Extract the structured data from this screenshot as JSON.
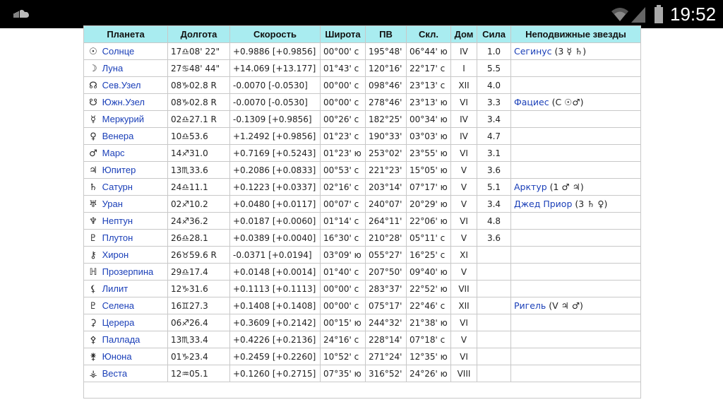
{
  "status_bar": {
    "time": "19:52",
    "icons": [
      "soundcloud-icon",
      "wifi-icon",
      "signal-icon",
      "battery-icon"
    ]
  },
  "table": {
    "headers": [
      "Планета",
      "Долгота",
      "Скорость",
      "Широта",
      "ПВ",
      "Скл.",
      "Дом",
      "Сила",
      "Неподвижные звезды"
    ],
    "rows": [
      {
        "sym": "☉",
        "planet": "Солнце",
        "long": "17♎08' 22\"",
        "speed": "+0.9886  [+0.9856]",
        "lat": "00°00' с",
        "ra": "195°48'",
        "dec": "06°44' ю",
        "house": "IV",
        "power": "1.0",
        "star": "Сегинус",
        "star_cfg": " (3 ☿ ♄)"
      },
      {
        "sym": "☽",
        "planet": "Луна",
        "long": "27♋48' 44\"",
        "speed": "+14.069  [+13.177]",
        "lat": "01°43' с",
        "ra": "120°16'",
        "dec": "22°17' с",
        "house": "I",
        "power": "5.5",
        "star": "",
        "star_cfg": ""
      },
      {
        "sym": "☊",
        "planet": "Сев.Узел",
        "long": "08♑02.8  R",
        "speed": "-0.0070  [-0.0530]",
        "lat": "00°00' с",
        "ra": "098°46'",
        "dec": "23°13' с",
        "house": "XII",
        "power": "4.0",
        "star": "",
        "star_cfg": ""
      },
      {
        "sym": "☋",
        "planet": "Южн.Узел",
        "long": "08♑02.8  R",
        "speed": "-0.0070  [-0.0530]",
        "lat": "00°00' с",
        "ra": "278°46'",
        "dec": "23°13' ю",
        "house": "VI",
        "power": "3.3",
        "star": "Фациес",
        "star_cfg": " (С ☉♂)"
      },
      {
        "sym": "☿",
        "planet": "Меркурий",
        "long": "02♎27.1  R",
        "speed": "-0.1309  [+0.9856]",
        "lat": "00°26' с",
        "ra": "182°25'",
        "dec": "00°34' ю",
        "house": "IV",
        "power": "3.4",
        "star": "",
        "star_cfg": ""
      },
      {
        "sym": "♀",
        "planet": "Венера",
        "long": "10♎53.6",
        "speed": "+1.2492  [+0.9856]",
        "lat": "01°23' с",
        "ra": "190°33'",
        "dec": "03°03' ю",
        "house": "IV",
        "power": "4.7",
        "star": "",
        "star_cfg": ""
      },
      {
        "sym": "♂",
        "planet": "Марс",
        "long": "14♐31.0",
        "speed": "+0.7169  [+0.5243]",
        "lat": "01°23' ю",
        "ra": "253°02'",
        "dec": "23°55' ю",
        "house": "VI",
        "power": "3.1",
        "star": "",
        "star_cfg": ""
      },
      {
        "sym": "♃",
        "planet": "Юпитер",
        "long": "13♏33.6",
        "speed": "+0.2086  [+0.0833]",
        "lat": "00°53' с",
        "ra": "221°23'",
        "dec": "15°05' ю",
        "house": "V",
        "power": "3.6",
        "star": "",
        "star_cfg": ""
      },
      {
        "sym": "♄",
        "planet": "Сатурн",
        "long": "24♎11.1",
        "speed": "+0.1223  [+0.0337]",
        "lat": "02°16' с",
        "ra": "203°14'",
        "dec": "07°17' ю",
        "house": "V",
        "power": "5.1",
        "star": "Арктур",
        "star_cfg": " (1 ♂ ♃)"
      },
      {
        "sym": "♅",
        "planet": "Уран",
        "long": "02♐10.2",
        "speed": "+0.0480  [+0.0117]",
        "lat": "00°07' с",
        "ra": "240°07'",
        "dec": "20°29' ю",
        "house": "V",
        "power": "3.4",
        "star": "Джед Приор",
        "star_cfg": " (3 ♄ ♀)"
      },
      {
        "sym": "♆",
        "planet": "Нептун",
        "long": "24♐36.2",
        "speed": "+0.0187  [+0.0060]",
        "lat": "01°14' с",
        "ra": "264°11'",
        "dec": "22°06' ю",
        "house": "VI",
        "power": "4.8",
        "star": "",
        "star_cfg": ""
      },
      {
        "sym": "♇",
        "planet": "Плутон",
        "long": "26♎28.1",
        "speed": "+0.0389  [+0.0040]",
        "lat": "16°30' с",
        "ra": "210°28'",
        "dec": "05°11' с",
        "house": "V",
        "power": "3.6",
        "star": "",
        "star_cfg": ""
      },
      {
        "sym": "⚷",
        "planet": "Хирон",
        "long": "26♉59.6  R",
        "speed": "-0.0371  [+0.0194]",
        "lat": "03°09' ю",
        "ra": "055°27'",
        "dec": "16°25' с",
        "house": "XI",
        "power": "",
        "star": "",
        "star_cfg": ""
      },
      {
        "sym": "ℍ",
        "planet": "Прозерпина",
        "long": "29♎17.4",
        "speed": "+0.0148  [+0.0014]",
        "lat": "01°40' с",
        "ra": "207°50'",
        "dec": "09°40' ю",
        "house": "V",
        "power": "",
        "star": "",
        "star_cfg": ""
      },
      {
        "sym": "⚸",
        "planet": "Лилит",
        "long": "12♑31.6",
        "speed": "+0.1113  [+0.1113]",
        "lat": "00°00' с",
        "ra": "283°37'",
        "dec": "22°52' ю",
        "house": "VII",
        "power": "",
        "star": "",
        "star_cfg": ""
      },
      {
        "sym": "♇",
        "planet": "Селена",
        "long": "16♊27.3",
        "speed": "+0.1408  [+0.1408]",
        "lat": "00°00' с",
        "ra": "075°17'",
        "dec": "22°46' с",
        "house": "XII",
        "power": "",
        "star": "Ригель",
        "star_cfg": " (V ♃ ♂)"
      },
      {
        "sym": "⚳",
        "planet": "Церера",
        "long": "06♐26.4",
        "speed": "+0.3609  [+0.2142]",
        "lat": "00°15' ю",
        "ra": "244°32'",
        "dec": "21°38' ю",
        "house": "VI",
        "power": "",
        "star": "",
        "star_cfg": ""
      },
      {
        "sym": "⚴",
        "planet": "Паллада",
        "long": "13♏33.4",
        "speed": "+0.4226  [+0.2136]",
        "lat": "24°16' с",
        "ra": "228°14'",
        "dec": "07°18' с",
        "house": "V",
        "power": "",
        "star": "",
        "star_cfg": ""
      },
      {
        "sym": "⚵",
        "planet": "Юнона",
        "long": "01♑23.4",
        "speed": "+0.2459  [+0.2260]",
        "lat": "10°52' с",
        "ra": "271°24'",
        "dec": "12°35' ю",
        "house": "VI",
        "power": "",
        "star": "",
        "star_cfg": ""
      },
      {
        "sym": "⚶",
        "planet": "Веста",
        "long": "12♒05.1",
        "speed": "+0.1260  [+0.2715]",
        "lat": "07°35' ю",
        "ra": "316°52'",
        "dec": "24°26' ю",
        "house": "VIII",
        "power": "",
        "star": "",
        "star_cfg": ""
      }
    ]
  }
}
